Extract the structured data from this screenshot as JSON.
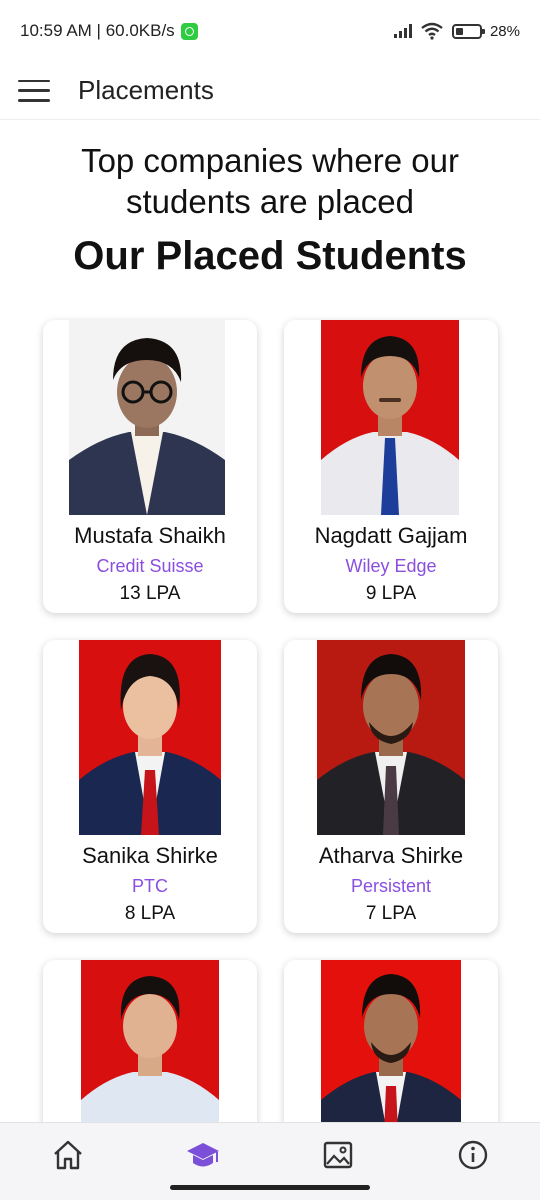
{
  "status_bar": {
    "time_speed": "10:59 AM | 60.0KB/s",
    "battery": "28%"
  },
  "app_bar": {
    "title": "Placements"
  },
  "page": {
    "headline_line1": "Top companies where our",
    "headline_line2": "students are placed",
    "subheading": "Our Placed Students"
  },
  "students": [
    {
      "name": "Mustafa Shaikh",
      "company": "Credit Suisse",
      "package": "13 LPA"
    },
    {
      "name": "Nagdatt Gajjam",
      "company": "Wiley Edge",
      "package": "9 LPA"
    },
    {
      "name": "Sanika Shirke",
      "company": "PTC",
      "package": "8 LPA"
    },
    {
      "name": "Atharva Shirke",
      "company": "Persistent",
      "package": "7 LPA"
    },
    {
      "name": "",
      "company": "",
      "package": ""
    },
    {
      "name": "",
      "company": "",
      "package": ""
    }
  ],
  "bottom_nav": {
    "items": [
      "home-icon",
      "graduation-cap-icon",
      "gallery-icon",
      "info-icon"
    ],
    "active": "graduation-cap-icon",
    "active_color": "#7b4fd8"
  },
  "colors": {
    "accent": "#8a4fe0",
    "photo_background_red": "#d80f0f"
  }
}
